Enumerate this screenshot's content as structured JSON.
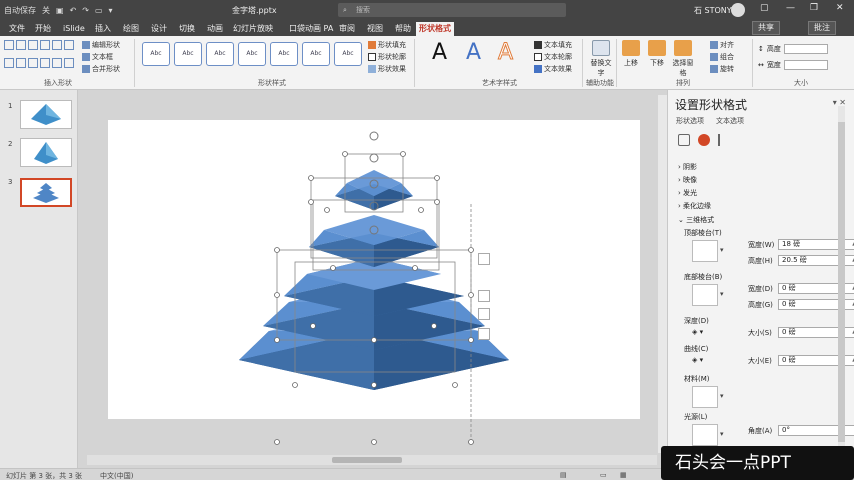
{
  "titlebar": {
    "autosave": "自动保存",
    "autosave_state": "关",
    "filename": "金字塔.pptx",
    "search_placeholder": "搜索",
    "user": "石 STONY"
  },
  "tabs": [
    "文件",
    "开始",
    "iSlide",
    "插入",
    "绘图",
    "设计",
    "切换",
    "动画",
    "幻灯片放映",
    "口袋动画 PA",
    "审阅",
    "视图",
    "帮助",
    "形状格式"
  ],
  "tab_active": "形状格式",
  "share_label": "共享",
  "comment_label": "批注",
  "ribbon": {
    "insert_shapes_label": "插入形状",
    "edit_shape": "编辑形状",
    "text_box": "文本框",
    "merge_shapes": "合并形状",
    "shape_styles_label": "形状样式",
    "style_sample": "Abc",
    "shape_fill": "形状填充",
    "shape_outline": "形状轮廓",
    "shape_effects": "形状效果",
    "wordart_label": "艺术字样式",
    "wordart_letter": "A",
    "text_fill": "文本填充",
    "text_outline": "文本轮廓",
    "text_effects": "文本效果",
    "alt_text": "替换文字",
    "accessibility_label": "辅助功能",
    "arrange_label": "排列",
    "bring_forward": "上移",
    "send_backward": "下移",
    "selection_pane": "选择窗格",
    "align": "对齐",
    "group": "组合",
    "rotate": "旋转",
    "size_label": "大小",
    "height": "高度",
    "width": "宽度"
  },
  "slides": [
    {
      "number": "1"
    },
    {
      "number": "2"
    },
    {
      "number": "3"
    }
  ],
  "pane": {
    "title": "设置形状格式",
    "tab_shape": "形状选项",
    "tab_text": "文本选项",
    "sections": [
      "阴影",
      "映像",
      "发光",
      "柔化边缘",
      "三维格式"
    ],
    "top_bevel": "顶部棱台(T)",
    "bottom_bevel": "底部棱台(B)",
    "width_label": "宽度(W)",
    "width_value": "18 磅",
    "height_label": "高度(H)",
    "height_value": "20.5 磅",
    "width2_label": "宽度(D)",
    "width2_value": "0 磅",
    "height2_label": "高度(G)",
    "height2_value": "0 磅",
    "depth_label": "深度(D)",
    "depth_size_label": "大小(S)",
    "depth_size_value": "0 磅",
    "contour_label": "曲线(C)",
    "contour_size_label": "大小(E)",
    "contour_size_value": "0 磅",
    "material_label": "材料(M)",
    "lighting_label": "光源(L)",
    "angle_label": "角度(A)",
    "angle_value": "0°"
  },
  "status": {
    "slide_info": "幻灯片 第 3 张，共 3 张",
    "language": "中文(中国)"
  },
  "watermark": "石头会一点PPT",
  "colors": {
    "pyramid_top": "#5b8fd0",
    "pyramid_side_left": "#3f6fa8",
    "pyramid_side_right": "#2e5a8f",
    "accent": "#d24726"
  }
}
